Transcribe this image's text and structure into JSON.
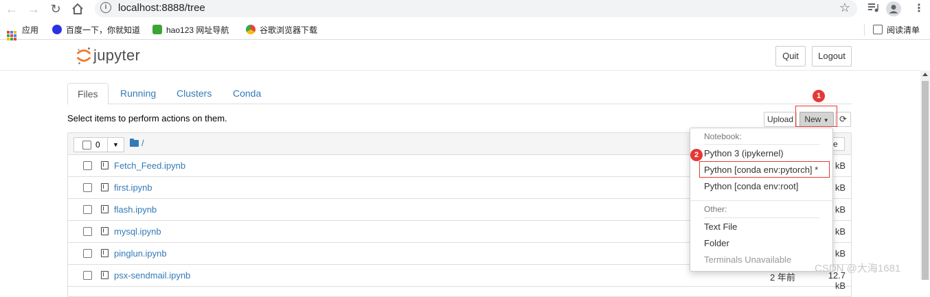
{
  "browser": {
    "url": "localhost:8888/tree",
    "bookmarks": [
      {
        "label": "应用"
      },
      {
        "label": "百度一下，你就知道"
      },
      {
        "label": "hao123 网址导航"
      },
      {
        "label": "谷歌浏览器下载"
      }
    ],
    "reading_list": "阅读清单"
  },
  "header": {
    "logo_text": "jupyter",
    "quit_label": "Quit",
    "logout_label": "Logout"
  },
  "tabs": [
    {
      "label": "Files",
      "active": true
    },
    {
      "label": "Running",
      "active": false
    },
    {
      "label": "Clusters",
      "active": false
    },
    {
      "label": "Conda",
      "active": false
    }
  ],
  "toolbar": {
    "select_message": "Select items to perform actions on them.",
    "upload_label": "Upload",
    "new_label": "New",
    "refresh_icon": "refresh-icon"
  },
  "list": {
    "selected_count": "0",
    "breadcrumb": "/",
    "size_header": "ze",
    "files": [
      {
        "name": "Fetch_Feed.ipynb",
        "modified": "",
        "size": "kB"
      },
      {
        "name": "first.ipynb",
        "modified": "",
        "size": "kB"
      },
      {
        "name": "flash.ipynb",
        "modified": "",
        "size": "kB"
      },
      {
        "name": "mysql.ipynb",
        "modified": "",
        "size": "kB"
      },
      {
        "name": "pinglun.ipynb",
        "modified": "",
        "size": "kB"
      },
      {
        "name": "psx-sendmail.ipynb",
        "modified": "2 年前",
        "size": "12.7 kB"
      }
    ]
  },
  "dropdown": {
    "notebook_header": "Notebook:",
    "kernels": [
      "Python 3 (ipykernel)",
      "Python [conda env:pytorch] *",
      "Python [conda env:root]"
    ],
    "other_header": "Other:",
    "other_items": [
      "Text File",
      "Folder"
    ],
    "terminals": "Terminals Unavailable"
  },
  "annotations": {
    "badge1": "1",
    "badge2": "2"
  },
  "colors": {
    "link": "#337ab7",
    "annotation_red": "#e53935",
    "jupyter_orange": "#f37726"
  },
  "watermark": "CSDN @大海1681"
}
